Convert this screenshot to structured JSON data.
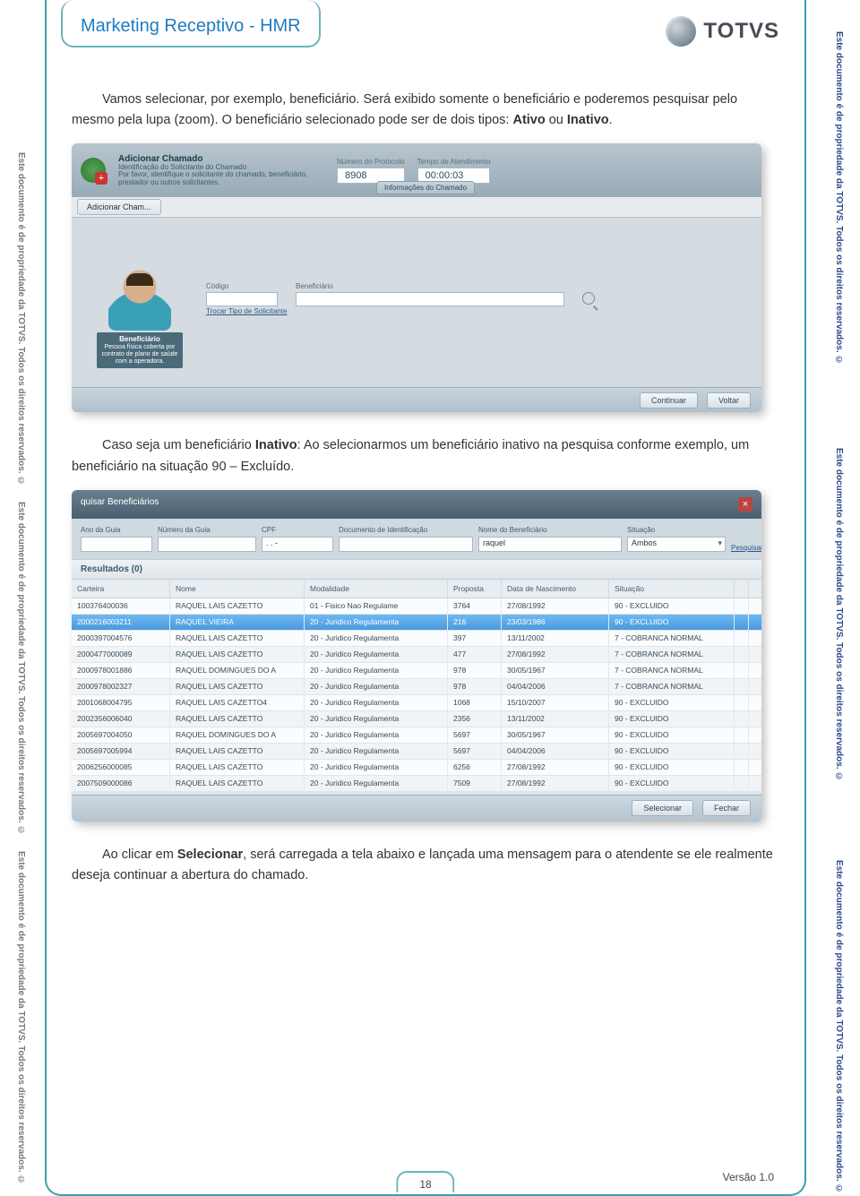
{
  "header": {
    "title": "Marketing Receptivo - HMR",
    "brand": "TOTVS"
  },
  "side_text_right": "Este documento é de propriedade da TOTVS. Todos os direitos reservados. ©",
  "side_text_left": "Este documento é de propriedade da TOTVS. Todos os direitos reservados. ©",
  "para1_a": "Vamos selecionar, por exemplo, beneficiário. Será exibido somente o beneficiário e poderemos pesquisar pelo mesmo pela lupa (zoom). O beneficiário selecionado pode ser de dois tipos: ",
  "para1_b1": "Ativo",
  "para1_mid": " ou ",
  "para1_b2": "Inativo",
  "para1_end": ".",
  "para2_a": "Caso seja um beneficiário ",
  "para2_b": "Inativo",
  "para2_c": ": Ao selecionarmos um beneficiário inativo na pesquisa conforme exemplo, um beneficiário na situação 90 – Excluído.",
  "para3_a": "Ao clicar em ",
  "para3_b": "Selecionar",
  "para3_c": ", será carregada a tela abaixo e lançada uma mensagem para o atendente se ele realmente deseja continuar a abertura do chamado.",
  "shot1": {
    "title": "Adicionar Chamado",
    "subtitle": "Identificação do Solicitante do Chamado",
    "subdesc": "Por favor, identifique o solicitante do chamado, beneficiário, prestador ou outros solicitantes.",
    "proto_lbl": "Número do Protocolo",
    "proto_val": "8908",
    "tempo_lbl": "Tempo de Atendimento",
    "tempo_val": "00:00:03",
    "tab_info": "Informações do Chamado",
    "tab_add": "Adicionar Cham...",
    "avatar_title": "Beneficiário",
    "avatar_desc": "Pessoa física coberta por contrato de plano de saúde com a operadora.",
    "codigo_lbl": "Código",
    "benef_lbl": "Beneficiário",
    "trocar": "Trocar Tipo de Solicitante",
    "btn_continuar": "Continuar",
    "btn_voltar": "Voltar"
  },
  "shot2": {
    "modal_title": "quisar Beneficiários",
    "filters": {
      "ano": "Ano da Guia",
      "numero": "Número da Guia",
      "cpf": "CPF",
      "cpf_placeholder": ".   .   -",
      "doc": "Documento de Identificação",
      "nome": "Nome do Beneficiário",
      "nome_val": "raquel",
      "sit": "Situação",
      "sit_val": "Ambos",
      "pesq": "Pesquisar"
    },
    "results_hdr": "Resultados (0)",
    "cols": {
      "carteira": "Carteira",
      "nome": "Nome",
      "modalidade": "Modalidade",
      "proposta": "Proposta",
      "nasc": "Data de Nascimento",
      "situacao": "Situação"
    },
    "rows": [
      {
        "c": "100376400036",
        "n": "RAQUEL LAIS CAZETTO",
        "m": "01 - Fisico Nao Regulame",
        "p": "3764",
        "d": "27/08/1992",
        "s": "90 - EXCLUIDO"
      },
      {
        "c": "2000216003211",
        "n": "RAQUEL VIEIRA",
        "m": "20 - Juridico Regulamenta",
        "p": "216",
        "d": "23/03/1986",
        "s": "90 - EXCLUIDO",
        "sel": true
      },
      {
        "c": "2000397004576",
        "n": "RAQUEL LAIS CAZETTO",
        "m": "20 - Juridico Regulamenta",
        "p": "397",
        "d": "13/11/2002",
        "s": "7 - COBRANCA NORMAL"
      },
      {
        "c": "2000477000089",
        "n": "RAQUEL LAIS CAZETTO",
        "m": "20 - Juridico Regulamenta",
        "p": "477",
        "d": "27/08/1992",
        "s": "7 - COBRANCA NORMAL"
      },
      {
        "c": "2000978001886",
        "n": "RAQUEL DOMINGUES DO A",
        "m": "20 - Juridico Regulamenta",
        "p": "978",
        "d": "30/05/1967",
        "s": "7 - COBRANCA NORMAL"
      },
      {
        "c": "2000978002327",
        "n": "RAQUEL LAIS CAZETTO",
        "m": "20 - Juridico Regulamenta",
        "p": "978",
        "d": "04/04/2006",
        "s": "7 - COBRANCA NORMAL"
      },
      {
        "c": "2001068004795",
        "n": "RAQUEL LAIS CAZETTO4",
        "m": "20 - Juridico Regulamenta",
        "p": "1068",
        "d": "15/10/2007",
        "s": "90 - EXCLUIDO"
      },
      {
        "c": "2002356006040",
        "n": "RAQUEL LAIS CAZETTO",
        "m": "20 - Juridico Regulamenta",
        "p": "2356",
        "d": "13/11/2002",
        "s": "90 - EXCLUIDO"
      },
      {
        "c": "2005697004050",
        "n": "RAQUEL DOMINGUES DO A",
        "m": "20 - Juridico Regulamenta",
        "p": "5697",
        "d": "30/05/1967",
        "s": "90 - EXCLUIDO"
      },
      {
        "c": "2005697005994",
        "n": "RAQUEL LAIS CAZETTO",
        "m": "20 - Juridico Regulamenta",
        "p": "5697",
        "d": "04/04/2006",
        "s": "90 - EXCLUIDO"
      },
      {
        "c": "2006256000085",
        "n": "RAQUEL LAIS CAZETTO",
        "m": "20 - Juridico Regulamenta",
        "p": "6256",
        "d": "27/08/1992",
        "s": "90 - EXCLUIDO"
      },
      {
        "c": "2007509000086",
        "n": "RAQUEL LAIS CAZETTO",
        "m": "20 - Juridico Regulamenta",
        "p": "7509",
        "d": "27/08/1992",
        "s": "90 - EXCLUIDO"
      }
    ],
    "btn_sel": "Selecionar",
    "btn_fechar": "Fechar"
  },
  "footer": {
    "page": "18",
    "version": "Versão 1.0"
  }
}
